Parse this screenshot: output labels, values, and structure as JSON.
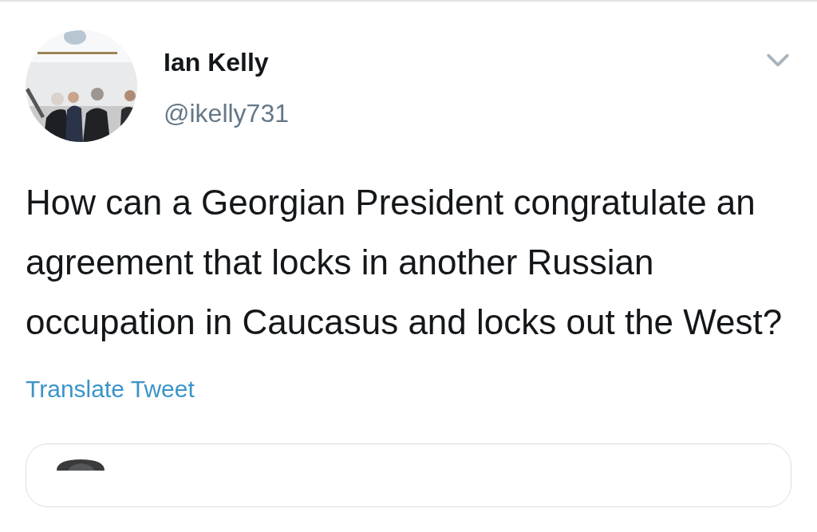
{
  "author": {
    "name": "Ian Kelly",
    "handle": "@ikelly731"
  },
  "tweet": {
    "text": "How can a Georgian President congratulate an agreement that locks in another Russian occupation in Caucasus and locks out the West?"
  },
  "translate_link": "Translate Tweet"
}
